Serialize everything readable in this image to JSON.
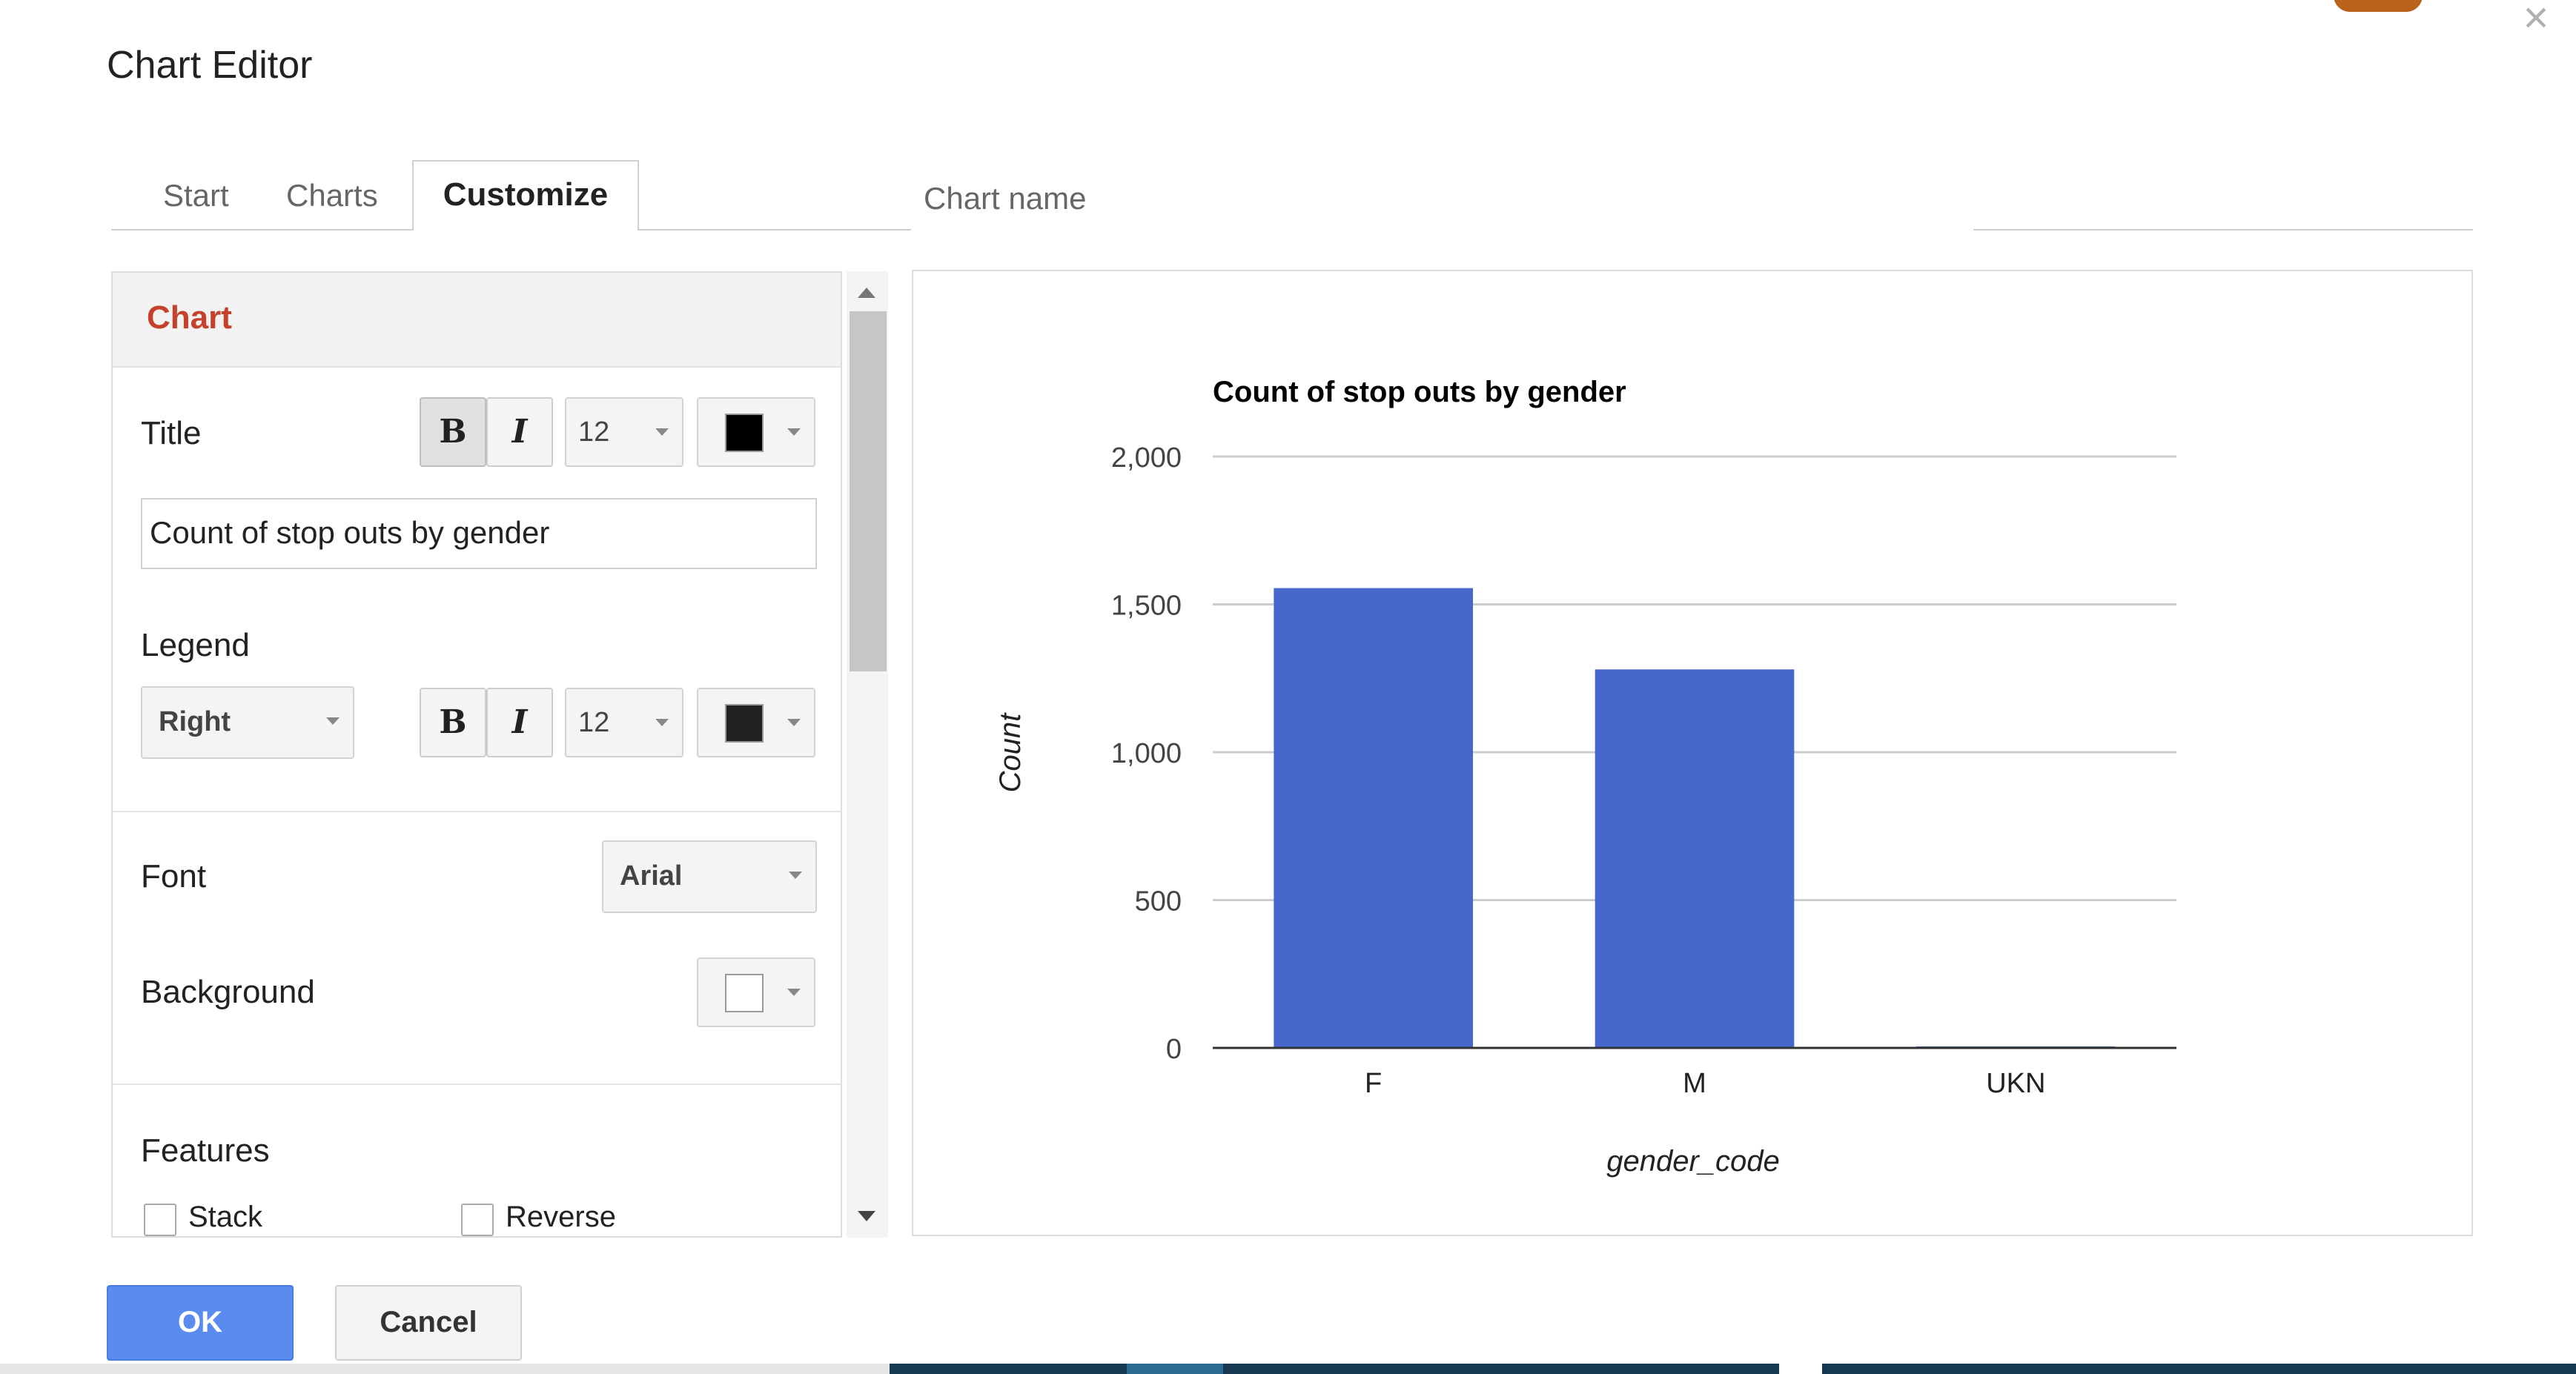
{
  "dialog": {
    "title": "Chart Editor",
    "close_icon": "close-icon"
  },
  "tabs": [
    {
      "label": "Start",
      "active": false
    },
    {
      "label": "Charts",
      "active": false
    },
    {
      "label": "Customize",
      "active": true
    }
  ],
  "chart_name": {
    "placeholder": "Chart name",
    "value": ""
  },
  "panel": {
    "section_title": "Chart",
    "title_row": {
      "label": "Title",
      "bold": "B",
      "italic": "I",
      "font_size": "12",
      "color": "#000000"
    },
    "title_value": "Count of stop outs by gender",
    "legend_row": {
      "label": "Legend",
      "position": "Right",
      "bold": "B",
      "italic": "I",
      "font_size": "12",
      "color": "#222222"
    },
    "font_row": {
      "label": "Font",
      "value": "Arial"
    },
    "background_row": {
      "label": "Background",
      "color": "#ffffff"
    },
    "features": {
      "label": "Features",
      "stack_label": "Stack",
      "stack_checked": false,
      "reverse_label": "Reverse",
      "reverse_checked": false
    }
  },
  "buttons": {
    "ok": "OK",
    "cancel": "Cancel"
  },
  "colors": {
    "accent": "#5a8cf0",
    "section_title": "#c4422b",
    "bar": "#4667cb"
  },
  "chart_data": {
    "type": "bar",
    "title": "Count of stop outs by gender",
    "xlabel": "gender_code",
    "ylabel": "Count",
    "categories": [
      "F",
      "M",
      "UKN"
    ],
    "values": [
      1555,
      1280,
      5
    ],
    "ylim": [
      0,
      2000
    ],
    "yticks": [
      0,
      500,
      1000,
      1500,
      2000
    ],
    "ytick_labels": [
      "0",
      "500",
      "1,000",
      "1,500",
      "2,000"
    ],
    "grid": true,
    "legend": "none"
  }
}
